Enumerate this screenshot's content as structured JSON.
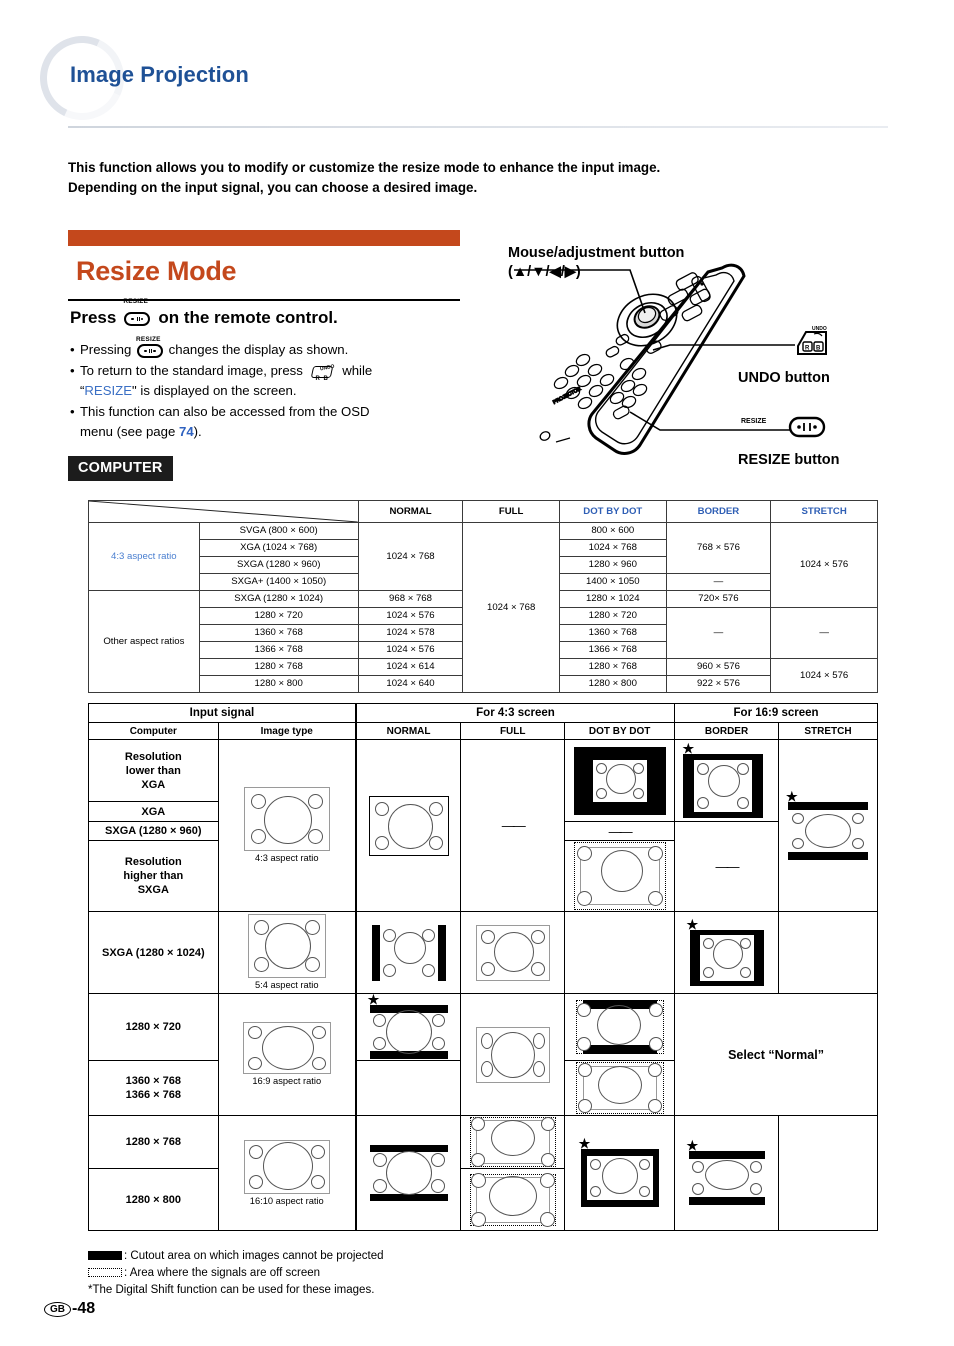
{
  "header": {
    "title": "Image Projection",
    "intro": "This function allows you to modify or customize the resize mode to enhance the input image. Depending on the input signal, you can choose a desired image."
  },
  "section": {
    "heading": "Resize Mode",
    "press_prefix": "Press",
    "press_suffix": "on the remote control.",
    "key_caption": "RESIZE",
    "undo_caption": "UNDO",
    "bullets": {
      "b1_pre": "Pressing",
      "b1_post": "changes the display as shown.",
      "b2_pre": "To return to the standard image, press",
      "b2_mid": "while",
      "b2_quote": "RESIZE",
      "b2_post": "\" is displayed on the screen.",
      "b3_pre": "This function can also be accessed from the OSD",
      "b3_post": "menu (see page",
      "b3_page": "74",
      "b3_end": ")."
    },
    "badge": "COMPUTER"
  },
  "remote": {
    "label_mouse_line1": "Mouse/adjustment button",
    "label_mouse_line2": "(▲/▼/◀/▶)",
    "label_undo": "UNDO button",
    "label_resize": "RESIZE button",
    "resize_cap": "RESIZE"
  },
  "spec_table": {
    "columns": [
      "",
      "",
      "NORMAL",
      "FULL",
      "DOT BY DOT",
      "BORDER",
      "STRETCH"
    ],
    "column_blue": [
      false,
      false,
      false,
      false,
      true,
      true,
      true
    ],
    "group1": {
      "label_black": "4:3",
      "label_blue": " aspect ratio",
      "rows": [
        {
          "res": "SVGA (800 × 600)",
          "dot": "800 × 600"
        },
        {
          "res": "XGA (1024 × 768)",
          "dot": "1024 × 768"
        },
        {
          "res": "SXGA (1280 × 960)",
          "dot": "1280 × 960"
        },
        {
          "res": "SXGA+ (1400 × 1050)",
          "dot": "1400 × 1050"
        }
      ],
      "normal": "1024 × 768",
      "border_first3": "768 × 576",
      "border_row4": "—",
      "stretch": "1024 × 576"
    },
    "group2": {
      "label": "Other aspect ratios",
      "rows": [
        {
          "res": "SXGA (1280 × 1024)",
          "normal": "968 × 768",
          "dot": "1280 × 1024",
          "border": "720× 576",
          "stretch": ""
        },
        {
          "res": "1280 × 720",
          "normal": "1024 × 576",
          "dot": "1280 × 720",
          "border": "—",
          "stretch": "—"
        },
        {
          "res": "1360 × 768",
          "normal": "1024 × 578",
          "dot": "1360 × 768",
          "border": "",
          "stretch": ""
        },
        {
          "res": "1366 × 768",
          "normal": "1024 × 576",
          "dot": "1366 × 768",
          "border": "",
          "stretch": ""
        },
        {
          "res": "1280 × 768",
          "normal": "1024 × 614",
          "dot": "1280 × 768",
          "border": "960 × 576",
          "stretch": "1024 × 576"
        },
        {
          "res": "1280 × 800",
          "normal": "1024 × 640",
          "dot": "1280 × 800",
          "border": "922 × 576",
          "stretch": ""
        }
      ]
    },
    "full_value": "1024 × 768"
  },
  "diagram_table": {
    "group_input": "Input signal",
    "group_43": "For 4:3 screen",
    "group_169": "For 16:9 screen",
    "col_computer": "Computer",
    "col_image_type": "Image type",
    "col_normal": "NORMAL",
    "col_full": "FULL",
    "col_dot": "DOT BY DOT",
    "col_border": "BORDER",
    "col_stretch": "STRETCH",
    "signals": [
      "Resolution\nlower than\nXGA",
      "XGA",
      "SXGA (1280 × 960)",
      "Resolution\nhigher than\nSXGA",
      "SXGA (1280 × 1024)",
      "1280 × 720",
      "1360 × 768\n1366 × 768",
      "1280 × 768",
      "1280 × 800"
    ],
    "sig_lower_than_xga": "Resolution lower than XGA",
    "sig_xga": "XGA",
    "sig_sxga960": "SXGA (1280 × 960)",
    "sig_higher_than_sxga": "Resolution higher than SXGA",
    "sig_sxga1024": "SXGA (1280 × 1024)",
    "sig_1280x720": "1280 × 720",
    "sig_1360_1366": "1360 × 768\n1366 × 768",
    "sig_1280x768": "1280 × 768",
    "sig_1280x800": "1280 × 800",
    "aspect_43": "4:3 aspect ratio",
    "aspect_54": "5:4 aspect ratio",
    "aspect_169": "16:9 aspect ratio",
    "aspect_1610": "16:10 aspect ratio",
    "select_normal": "Select “Normal”",
    "star": "★"
  },
  "footnotes": {
    "f1": ": Cutout area on which images cannot be projected",
    "f2": ": Area where the signals are off screen",
    "f3": "*The Digital Shift function can be used for these images."
  },
  "page": {
    "region": "GB",
    "number": "-48"
  },
  "colors": {
    "title_blue": "#1f5196",
    "accent_orange": "#c4481c",
    "header_blue": "#2f5fb5",
    "link_blue": "#2f62c0"
  }
}
